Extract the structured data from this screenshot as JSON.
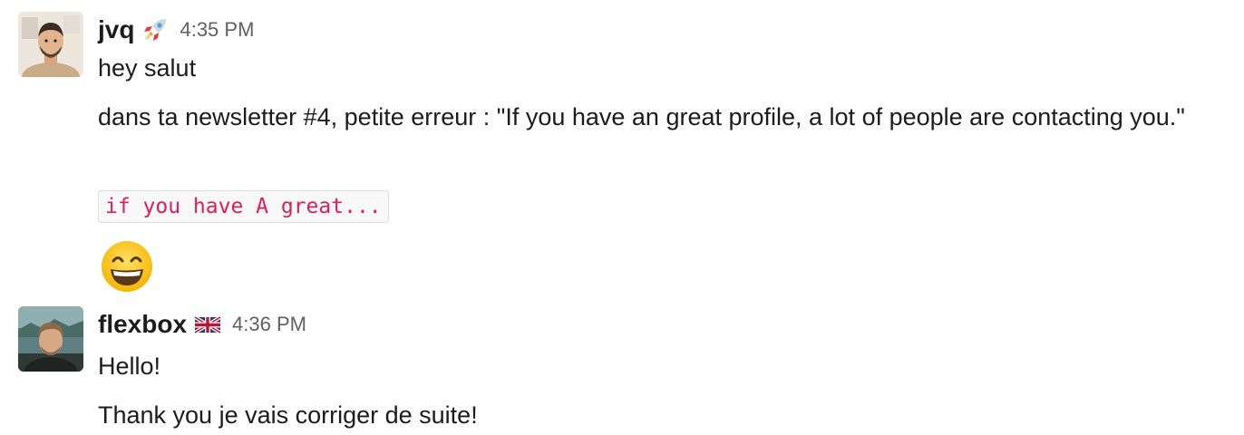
{
  "messages": [
    {
      "username": "jvq",
      "status_emoji": "rocket",
      "timestamp": "4:35 PM",
      "lines": [
        "hey salut",
        "dans ta newsletter #4, petite erreur : \"If you have an great profile, a lot of people are contacting you.\""
      ],
      "code": "if you have A great...",
      "reaction_emoji": "grinning-face-with-smiling-eyes"
    },
    {
      "username": "flexbox",
      "status_emoji": "uk-flag",
      "timestamp": "4:36 PM",
      "lines": [
        "Hello!",
        "Thank you je vais corriger de suite!"
      ]
    }
  ],
  "colors": {
    "text": "#1d1c1d",
    "timestamp": "#616061",
    "code_text": "#e01e5a",
    "code_bg": "#f8f8f8",
    "code_border": "#dcdcdc"
  }
}
